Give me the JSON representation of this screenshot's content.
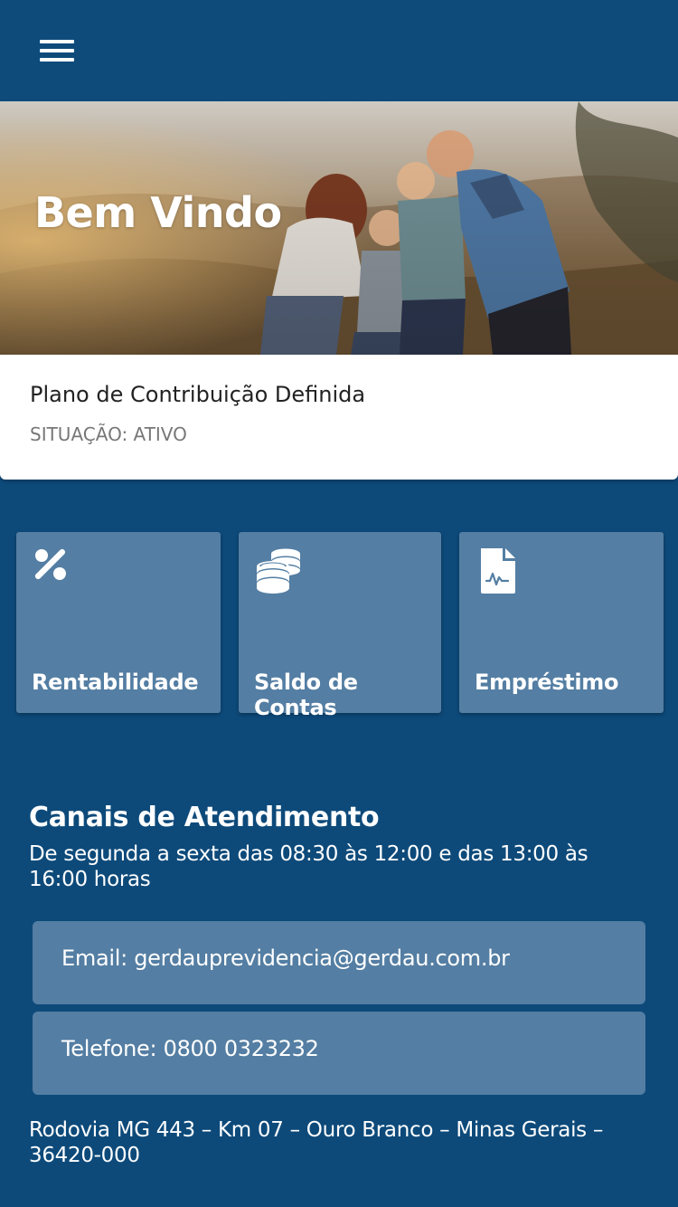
{
  "colors": {
    "background": "#0d4a7a",
    "tile": "#547ea3",
    "card": "#ffffff"
  },
  "header": {
    "menu_icon": "hamburger-menu-icon"
  },
  "hero": {
    "title": "Bem Vindo"
  },
  "plan": {
    "name": "Plano de Contribuição Definida",
    "status": "SITUAÇÃO: ATIVO"
  },
  "tiles": [
    {
      "label": "Rentabilidade",
      "icon": "percent-icon"
    },
    {
      "label": "Saldo de Contas",
      "icon": "coins-icon"
    },
    {
      "label": "Empréstimo",
      "icon": "document-signature-icon"
    }
  ],
  "contact": {
    "title": "Canais de Atendimento",
    "hours": "De segunda a sexta das 08:30 às 12:00 e das 13:00 às 16:00 horas",
    "email": "Email: gerdauprevidencia@gerdau.com.br",
    "phone": "Telefone: 0800 0323232",
    "address": "Rodovia MG 443 – Km 07 – Ouro Branco – Minas Gerais – 36420-000"
  }
}
